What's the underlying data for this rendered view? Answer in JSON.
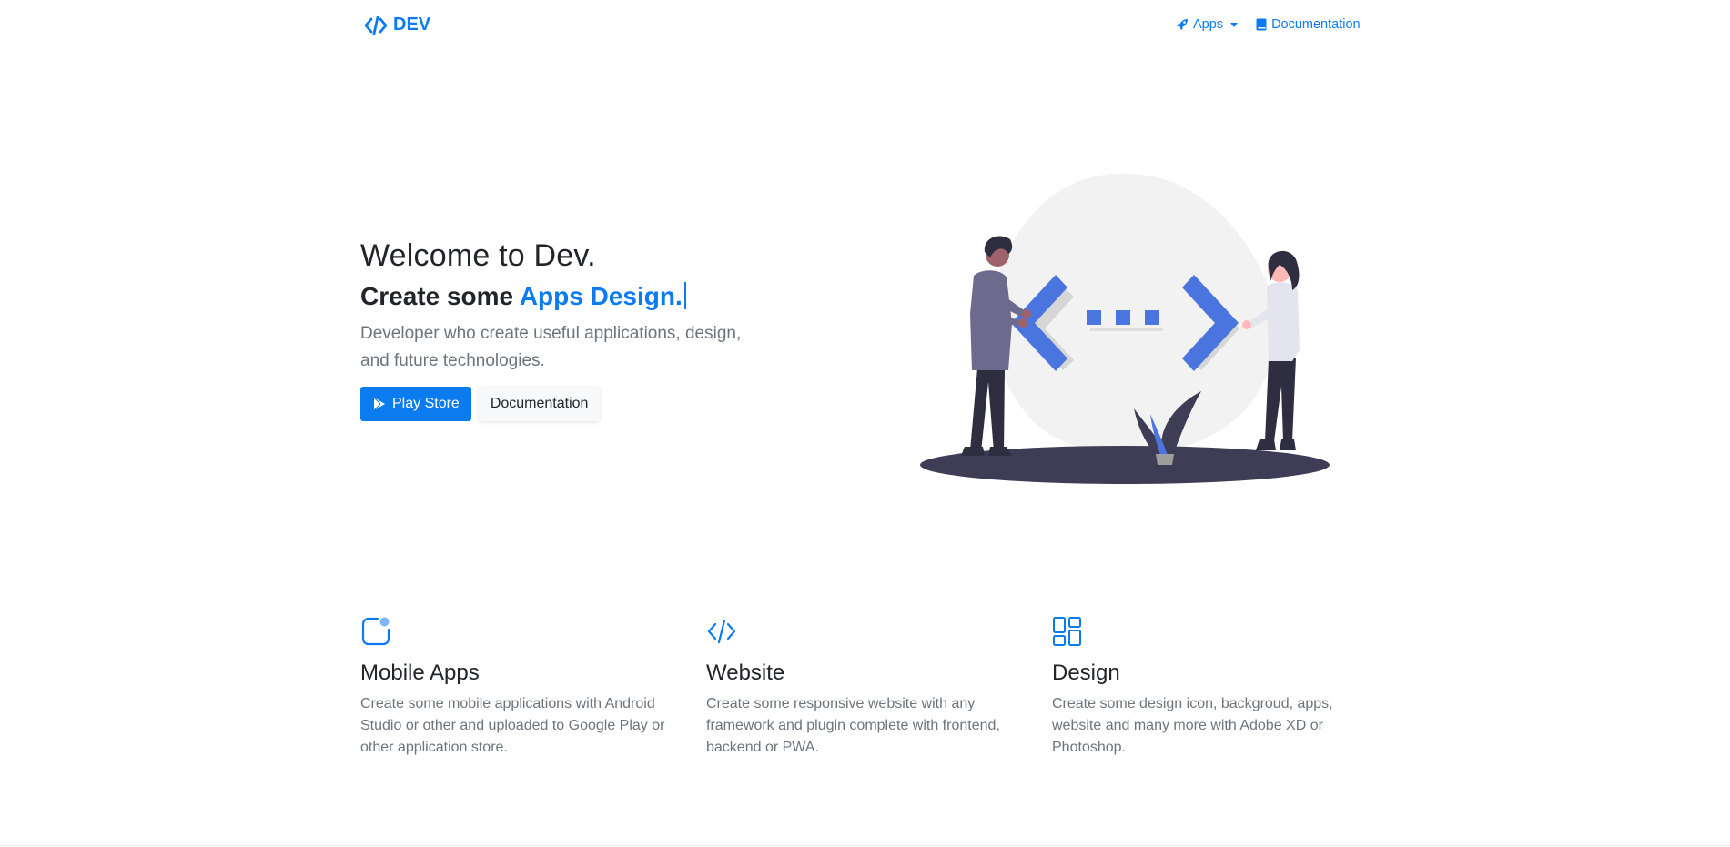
{
  "brand": {
    "name": "DEV",
    "icon": "code-icon"
  },
  "nav": {
    "apps_label": "Apps",
    "apps_icon": "rocket-icon",
    "docs_label": "Documentation",
    "docs_icon": "book-icon"
  },
  "hero": {
    "title": "Welcome to Dev.",
    "subtitle_prefix": "Create some ",
    "subtitle_accent": "Apps Design.",
    "description": "Developer who create useful applications, design, and future technologies.",
    "primary_button": "Play Store",
    "primary_button_icon": "play-icon",
    "secondary_button": "Documentation"
  },
  "features": [
    {
      "icon": "mobile-app-icon",
      "title": "Mobile Apps",
      "text": "Create some mobile applications with Android Studio or other and uploaded to Google Play or other application store."
    },
    {
      "icon": "code-icon",
      "title": "Website",
      "text": "Create some responsive website with any framework and plugin complete with frontend, backend or PWA."
    },
    {
      "icon": "layout-grid-icon",
      "title": "Design",
      "text": "Create some design icon, backgroud, apps, website and many more with Adobe XD or Photoshop."
    }
  ],
  "colors": {
    "accent": "#0d7bf0",
    "text": "#212529",
    "muted": "#6c757d",
    "illustration_blue": "#4a74de",
    "illustration_dark": "#3f3d56"
  }
}
